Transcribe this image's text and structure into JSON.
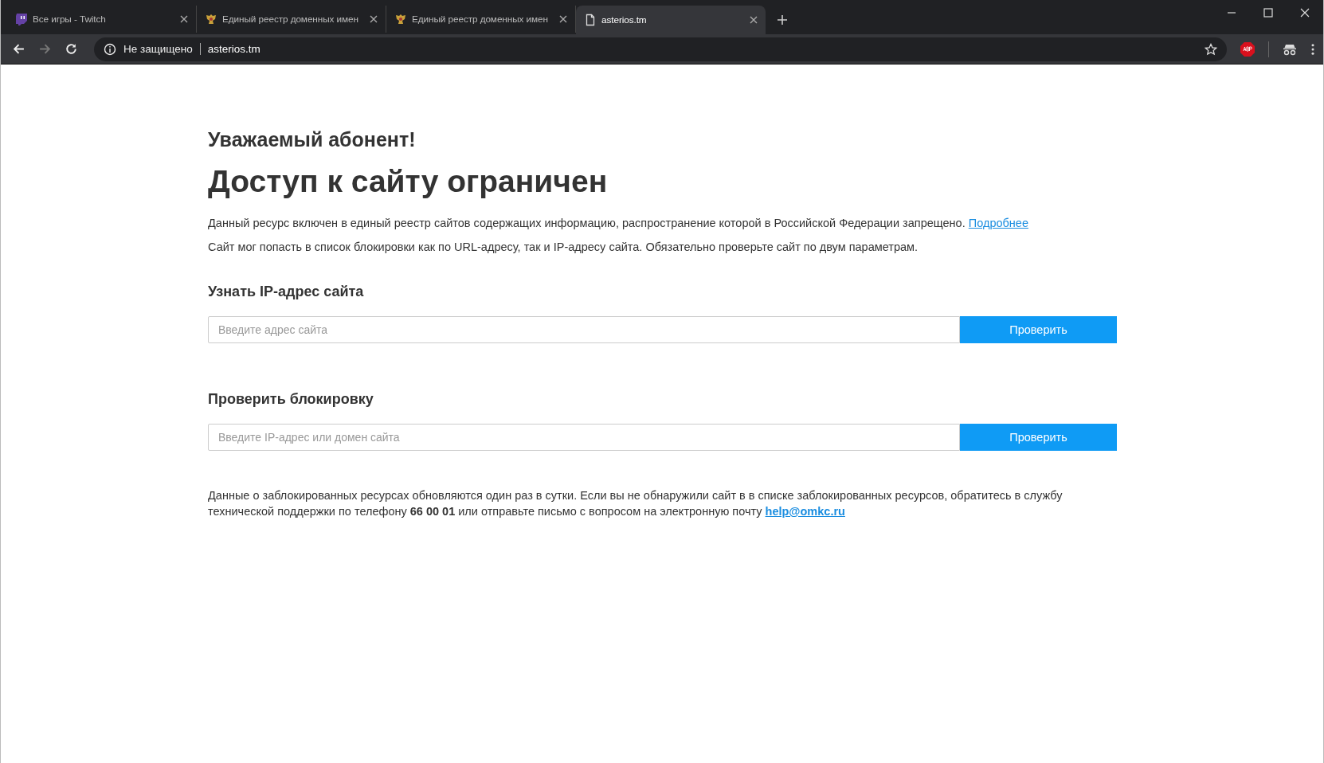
{
  "tabs": [
    {
      "kind": "twitch",
      "title": "Все игры - Twitch",
      "selected": false
    },
    {
      "kind": "emblem",
      "title": "Единый реестр доменных имен",
      "selected": false
    },
    {
      "kind": "emblem",
      "title": "Единый реестр доменных имен",
      "selected": false
    },
    {
      "kind": "page",
      "title": "asterios.tm",
      "selected": true
    }
  ],
  "address_bar": {
    "security": "Не защищено",
    "url": "asterios.tm"
  },
  "page": {
    "greeting": "Уважаемый абонент!",
    "title": "Доступ к сайту ограничен",
    "notice": {
      "text": "Данный ресурс включен в единый реестр сайтов содержащих информацию, распространение которой в Российской Федерации запрещено.",
      "link": "Подробнее"
    },
    "hint": "Сайт мог попасть в список блокировки как по URL-адресу, так и IP-адресу сайта. Обязательно проверьте сайт по двум параметрам.",
    "forms": [
      {
        "heading": "Узнать IP-адрес сайта",
        "placeholder": "Введите адрес сайта",
        "button": "Проверить"
      },
      {
        "heading": "Проверить блокировку",
        "placeholder": "Введите IP-адрес или домен сайта",
        "button": "Проверить"
      }
    ],
    "footer": {
      "text": "Данные о заблокированных ресурсах обновляются один раз в сутки. Если вы не обнаружили сайт в в списке заблокированных ресурсов, обратитесь в службу технической поддержки по телефону **66 00 01** или отправьте письмо с вопросом на электронную почту",
      "link": "help@omkc.ru"
    }
  }
}
